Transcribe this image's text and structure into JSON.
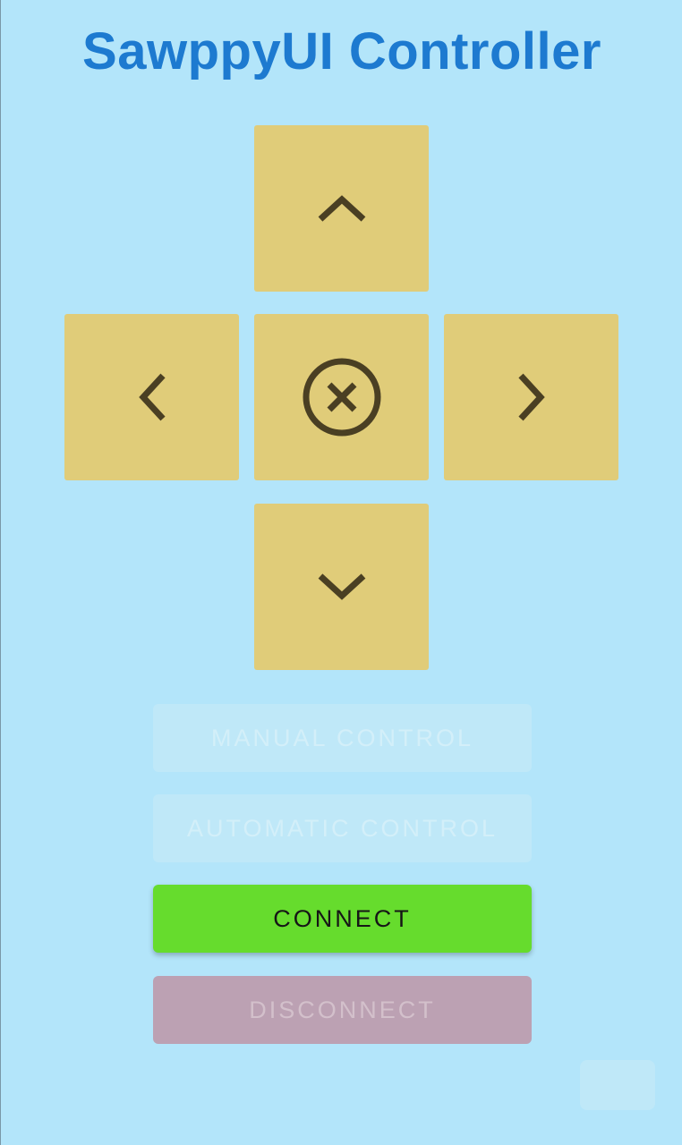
{
  "app": {
    "title": "SawppyUI Controller"
  },
  "dpad": {
    "up": {
      "icon": "chevron-up-icon"
    },
    "left": {
      "icon": "chevron-left-icon"
    },
    "center": {
      "icon": "cancel-circle-icon"
    },
    "right": {
      "icon": "chevron-right-icon"
    },
    "down": {
      "icon": "chevron-down-icon"
    }
  },
  "buttons": {
    "manual_label": "MANUAL CONTROL",
    "automatic_label": "AUTOMATIC CONTROL",
    "connect_label": "CONNECT",
    "disconnect_label": "DISCONNECT"
  },
  "colors": {
    "background": "#b3e5fa",
    "title": "#1d7ad0",
    "pad": "#e0cc79",
    "icon": "#4a3f23",
    "connect": "#66dc2d",
    "disconnect": "#bca1b3"
  }
}
